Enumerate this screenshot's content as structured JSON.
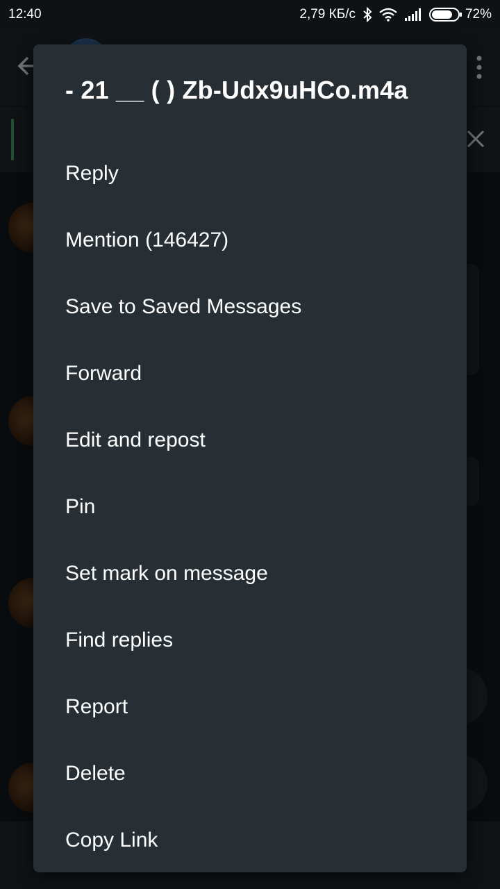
{
  "status_bar": {
    "time": "12:40",
    "net_speed": "2,79 КБ/с",
    "battery": "72%",
    "icons": [
      "bluetooth-icon",
      "wifi-icon",
      "signal-icon",
      "battery-icon"
    ]
  },
  "menu": {
    "title": "-  21 __ ( ) Zb-Udx9uHCo.m4a",
    "items": [
      {
        "label": "Reply"
      },
      {
        "label": "Mention (146427)"
      },
      {
        "label": "Save to Saved Messages"
      },
      {
        "label": "Forward"
      },
      {
        "label": "Edit and repost"
      },
      {
        "label": "Pin"
      },
      {
        "label": "Set mark on message"
      },
      {
        "label": "Find replies"
      },
      {
        "label": "Report"
      },
      {
        "label": "Delete"
      },
      {
        "label": "Copy Link"
      }
    ]
  },
  "colors": {
    "menu_background": "#272f35",
    "accent_green": "#4fae73",
    "status_bar": "#0e1215"
  }
}
